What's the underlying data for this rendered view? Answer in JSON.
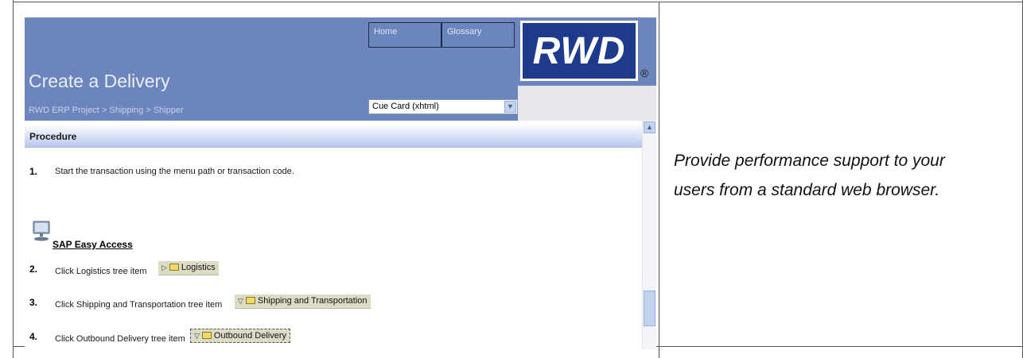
{
  "header": {
    "title": "Create a Delivery",
    "breadcrumb": "RWD ERP Project > Shipping > Shipper",
    "nav": {
      "home": "Home",
      "glossary": "Glossary"
    },
    "logo": {
      "text": "RWD",
      "mark": "®"
    },
    "view_select": {
      "value": "Cue Card (xhtml)"
    }
  },
  "procedure": {
    "heading": "Procedure",
    "steps": [
      {
        "num": "1.",
        "text": "Start the transaction using the menu path or transaction code."
      },
      {
        "num": "2.",
        "text": "Click Logistics tree item",
        "chip": "Logistics",
        "chip_icon": "triangle-right-icon"
      },
      {
        "num": "3.",
        "text": "Click Shipping and Transportation tree item",
        "chip": "Shipping and Transportation",
        "chip_icon": "triangle-down-icon"
      },
      {
        "num": "4.",
        "text": "Click Outbound Delivery tree item",
        "chip": "Outbound Delivery",
        "chip_icon": "triangle-down-icon"
      }
    ],
    "sap_link": "SAP Easy Access"
  },
  "tagline": {
    "line1": "Provide performance support to your",
    "line2": "users from a standard web browser."
  },
  "colors": {
    "header_bg": "#6c86bd",
    "logo_blue": "#1e3a8c",
    "chip_bg": "#dcdcc4"
  }
}
